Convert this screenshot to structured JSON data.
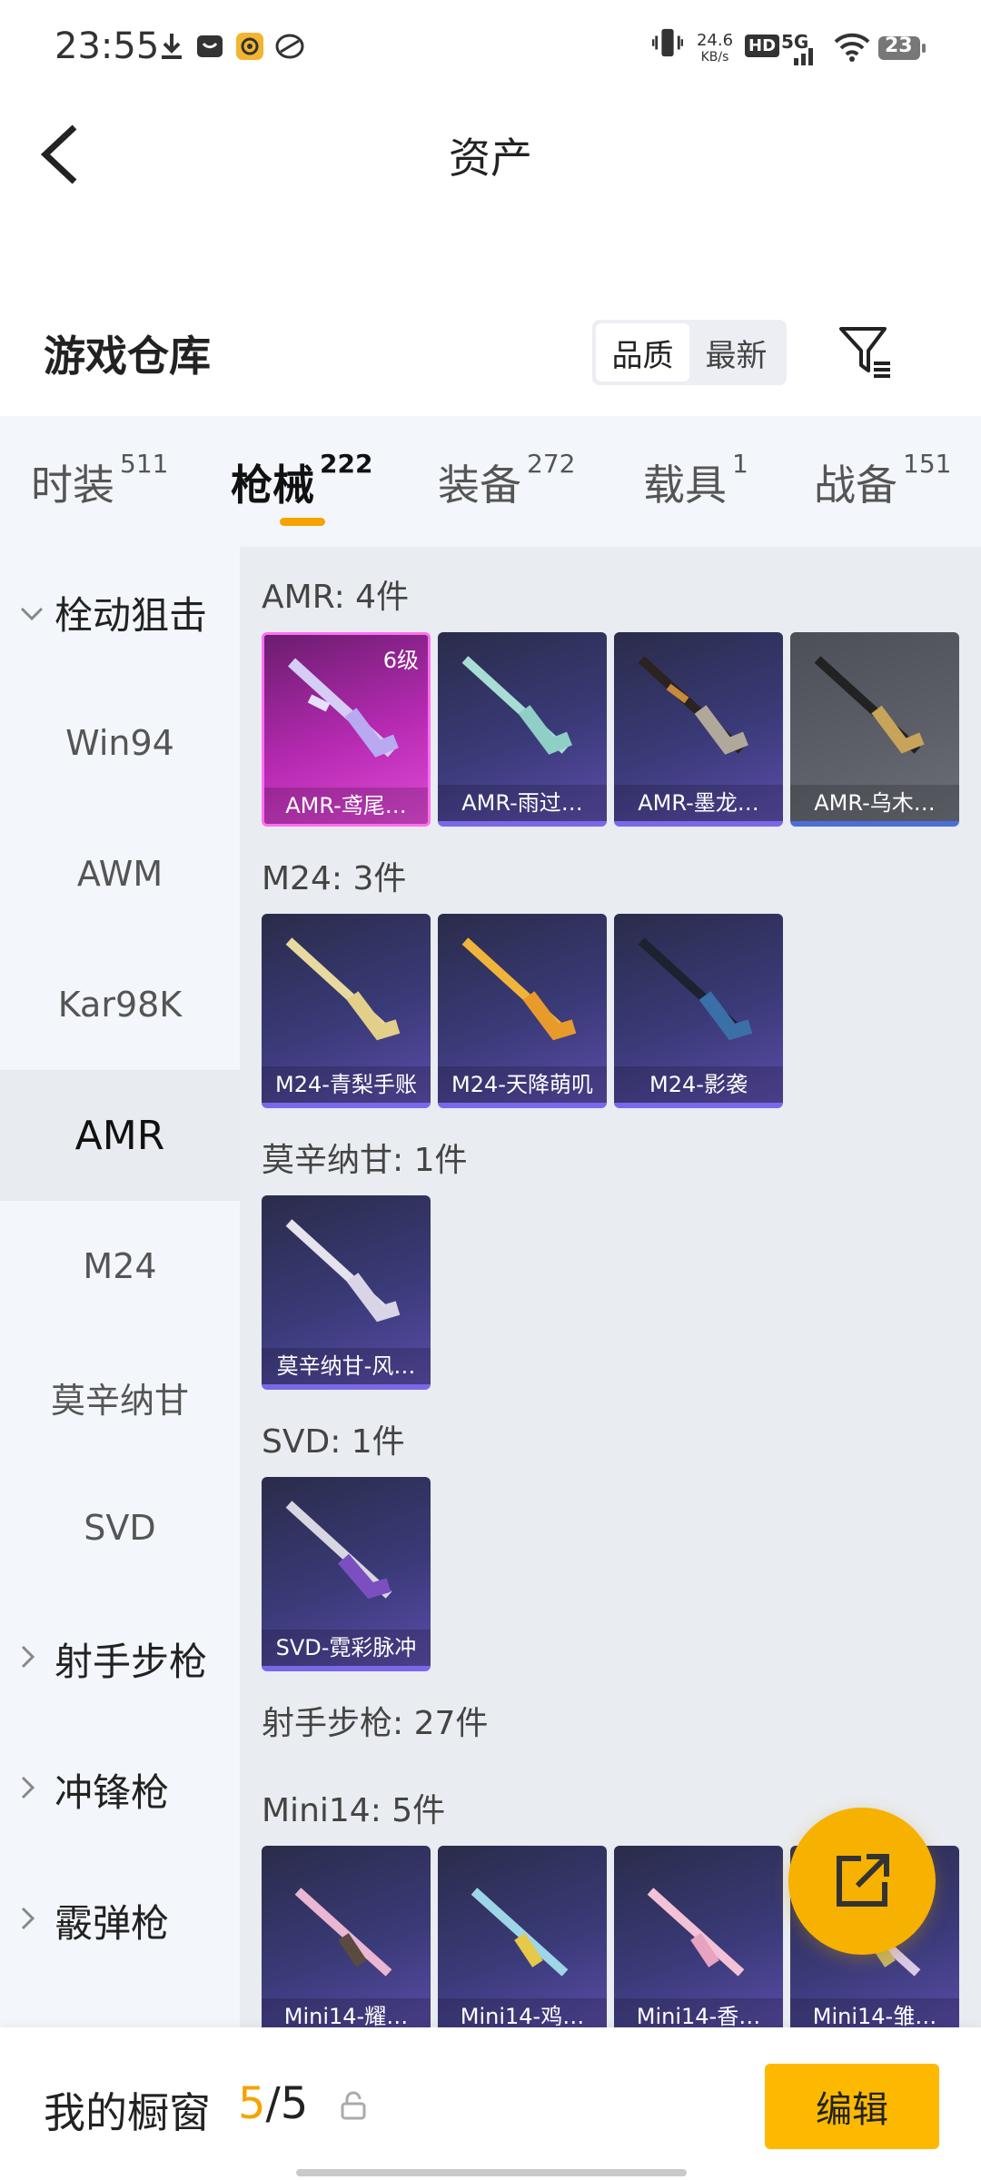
{
  "status_bar": {
    "time": "23:55",
    "net_speed_top": "24.6",
    "net_speed_bottom": "KB/s",
    "hd": "HD",
    "net": "5G",
    "battery": "23"
  },
  "header": {
    "title": "资产"
  },
  "warehouse": {
    "title": "游戏仓库",
    "sort_quality": "品质",
    "sort_newest": "最新"
  },
  "tabs": [
    {
      "label": "时装",
      "count": "511"
    },
    {
      "label": "枪械",
      "count": "222"
    },
    {
      "label": "装备",
      "count": "272"
    },
    {
      "label": "载具",
      "count": "1"
    },
    {
      "label": "战备",
      "count": "151"
    }
  ],
  "sidebar": {
    "items": [
      {
        "label": "栓动狙击"
      },
      {
        "label": "Win94"
      },
      {
        "label": "AWM"
      },
      {
        "label": "Kar98K"
      },
      {
        "label": "AMR"
      },
      {
        "label": "M24"
      },
      {
        "label": "莫辛纳甘"
      },
      {
        "label": "SVD"
      },
      {
        "label": "射手步枪"
      },
      {
        "label": "冲锋枪"
      },
      {
        "label": "霰弹枪"
      }
    ]
  },
  "sections": [
    {
      "label": "AMR: 4件",
      "items": [
        {
          "name": "AMR-鸢尾…",
          "level": "6级"
        },
        {
          "name": "AMR-雨过…"
        },
        {
          "name": "AMR-墨龙…"
        },
        {
          "name": "AMR-乌木…"
        }
      ]
    },
    {
      "label": "M24: 3件",
      "items": [
        {
          "name": "M24-青梨手账"
        },
        {
          "name": "M24-天降萌叽"
        },
        {
          "name": "M24-影袭"
        }
      ]
    },
    {
      "label": "莫辛纳甘: 1件",
      "items": [
        {
          "name": "莫辛纳甘-风…"
        }
      ]
    },
    {
      "label": "SVD: 1件",
      "items": [
        {
          "name": "SVD-霓彩脉冲"
        }
      ]
    },
    {
      "label": "射手步枪: 27件"
    },
    {
      "label": "Mini14: 5件",
      "items": [
        {
          "name": "Mini14-耀…"
        },
        {
          "name": "Mini14-鸡…"
        },
        {
          "name": "Mini14-香…"
        },
        {
          "name": "Mini14-雏…"
        }
      ]
    }
  ],
  "bottom_bar": {
    "title": "我的橱窗",
    "count_current": "5",
    "count_sep": "/",
    "count_total": "5",
    "edit_label": "编辑"
  },
  "colors": {
    "accent": "#f5a300",
    "button": "#fcb900"
  }
}
